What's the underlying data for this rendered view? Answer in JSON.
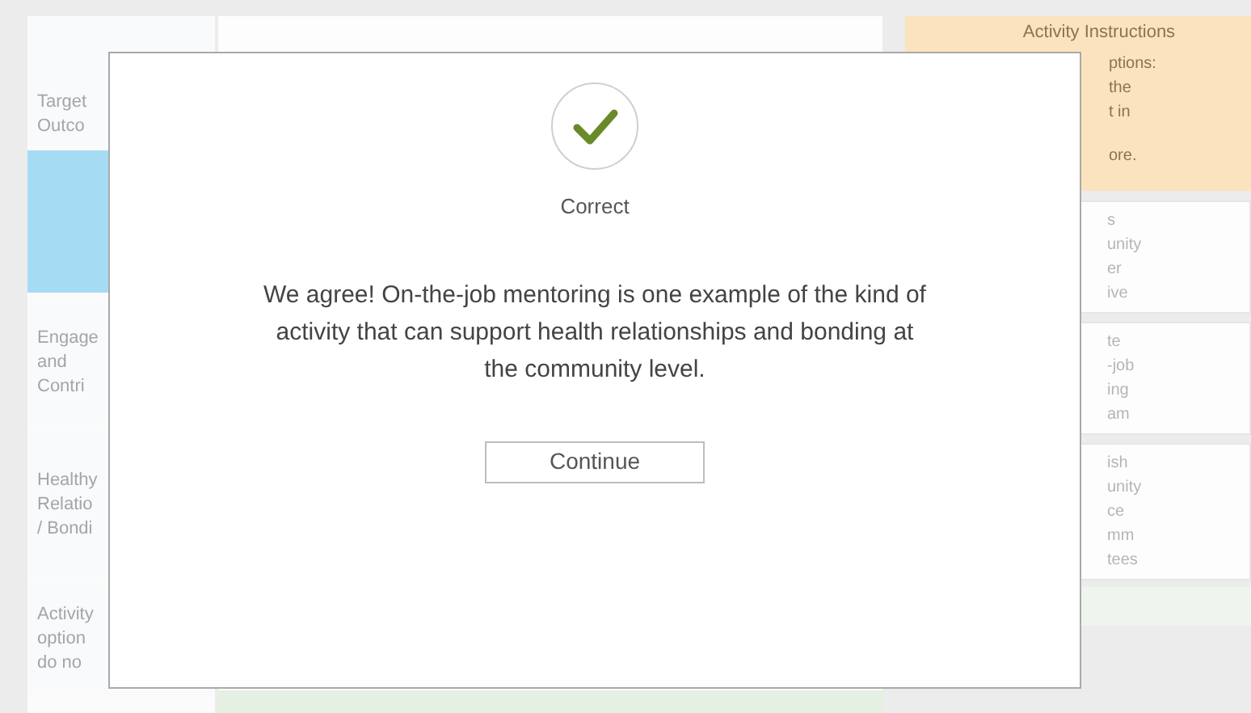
{
  "background": {
    "left_column": [
      {
        "lines": [
          "Target",
          "Outco"
        ],
        "selected": false
      },
      {
        "selected": true
      },
      {
        "lines": [
          "Engage",
          "and",
          "Contri"
        ],
        "selected": false
      },
      {
        "lines": [
          "Healthy",
          "Relatio",
          "/ Bondi"
        ],
        "selected": false
      },
      {
        "lines": [
          "Activity",
          "option",
          "do no"
        ],
        "selected": false
      }
    ],
    "instructions_title": "Activity Instructions",
    "instructions": [
      "ptions:",
      "the",
      "t in",
      "ore."
    ],
    "cards": [
      {
        "lines": [
          "s",
          "unity",
          "er",
          "ive"
        ]
      },
      {
        "lines": [
          "te",
          "-job",
          "ing",
          "am"
        ]
      },
      {
        "lines": [
          "ish",
          "unity",
          "ce",
          "mm",
          "tees"
        ]
      }
    ]
  },
  "dialog": {
    "correct": true,
    "status": "Correct",
    "message": "We agree! On-the-job mentoring is one example of the kind of activity that can support health relationships and bonding at the community level.",
    "button": "Continue"
  }
}
